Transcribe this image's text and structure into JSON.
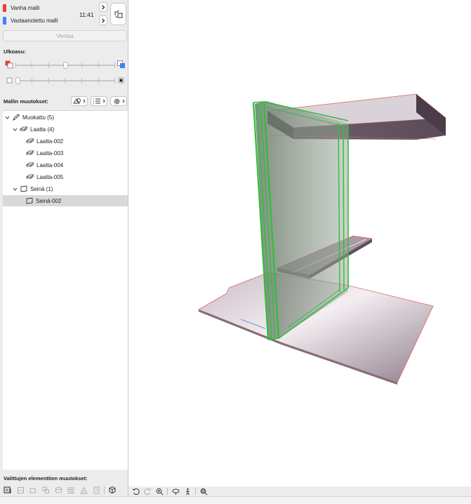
{
  "models": {
    "old_label": "Vanha malli",
    "received_label": "Vastaanotettu malli",
    "old_color": "#e8403a",
    "received_color": "#3b82f6",
    "time": "11:41"
  },
  "compare_button": "Vertaa",
  "appearance": {
    "label": "Ulkoasu:",
    "color_slider_value": 0.5,
    "transparency_slider_value": 0.0
  },
  "changes": {
    "label": "Mallin muutokset:"
  },
  "tree": {
    "modified": "Muokattu (5)",
    "slab_group": "Laatta (4)",
    "slabs": [
      "Laatta-002",
      "Laatta-003",
      "Laatta-004",
      "Laatta-005"
    ],
    "wall_group": "Seinä (1)",
    "walls": [
      "Seinä-002"
    ],
    "selected": "Seinä-002"
  },
  "selected_changes_label": "Valittujen elementtien muutokset:",
  "colors": {
    "highlight": "#2fbf3a",
    "slab_edge": "#e06060",
    "slab_fill": "#7e6f7a"
  }
}
